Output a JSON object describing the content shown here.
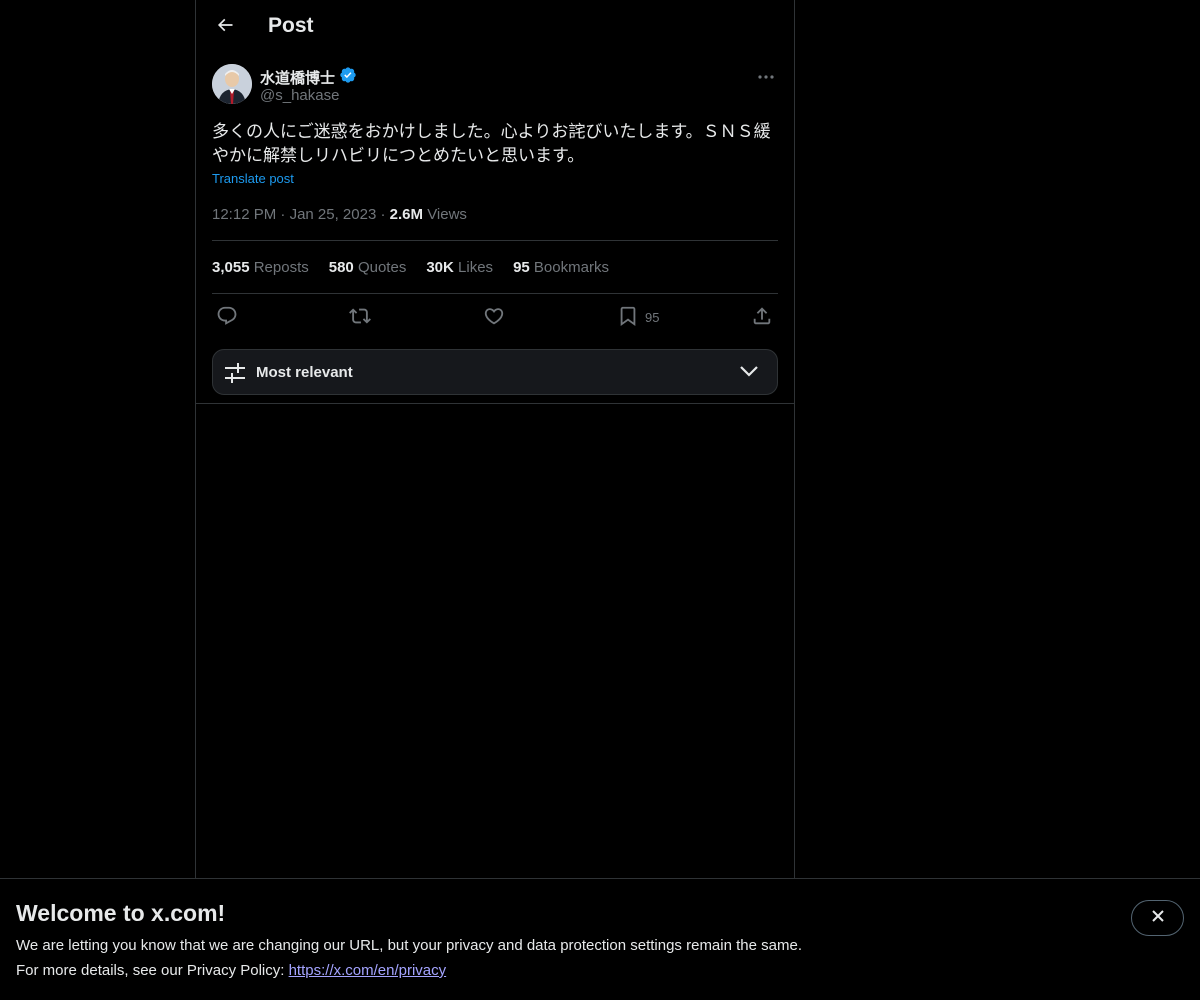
{
  "header": {
    "title": "Post"
  },
  "post": {
    "author_name": "水道橋博士",
    "author_handle": "@s_hakase",
    "text_line1": "多くの人にご迷惑をおかけしました。心よりお詫びいたします。ＳＮＳ緩",
    "text_line2": "やかに解禁しリハビリにつとめたいと思います。",
    "translate_label": "Translate post",
    "time": "12:12 PM",
    "date": "Jan 25, 2023",
    "views_count": "2.6M",
    "views_label": "Views"
  },
  "stats": {
    "reposts_count": "3,055",
    "reposts_label": "Reposts",
    "quotes_count": "580",
    "quotes_label": "Quotes",
    "likes_count": "30K",
    "likes_label": "Likes",
    "bookmarks_count": "95",
    "bookmarks_label": "Bookmarks"
  },
  "actions": {
    "bookmark_count": "95"
  },
  "sort": {
    "label": "Most relevant"
  },
  "banner": {
    "title": "Welcome to x.com!",
    "line1": "We are letting you know that we are changing our URL, but your privacy and data protection settings remain the same.",
    "line2_prefix": "For more details, see our Privacy Policy: ",
    "link": "https://x.com/en/privacy"
  },
  "colors": {
    "accent": "#1d9bf0",
    "background": "#000000",
    "muted": "#71767b",
    "link": "#a4a4ff"
  },
  "icons": [
    "back-arrow-icon",
    "verified-badge-icon",
    "more-icon",
    "reply-icon",
    "repost-icon",
    "like-icon",
    "bookmark-icon",
    "share-icon",
    "sort-sliders-icon",
    "chevron-down-icon",
    "close-icon"
  ]
}
